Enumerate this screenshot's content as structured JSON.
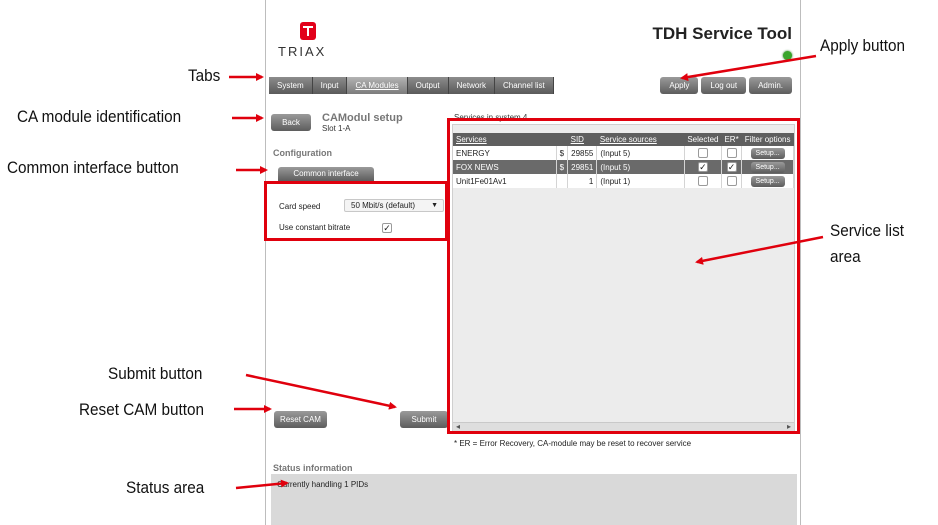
{
  "app": {
    "logo_text": "TRIAX",
    "title": "TDH Service Tool"
  },
  "tabs": [
    {
      "label": "System",
      "active": false
    },
    {
      "label": "Input",
      "active": false
    },
    {
      "label": "CA Modules",
      "active": true
    },
    {
      "label": "Output",
      "active": false
    },
    {
      "label": "Network",
      "active": false
    },
    {
      "label": "Channel list",
      "active": false
    }
  ],
  "top_buttons": {
    "apply": "Apply",
    "logout": "Log out",
    "admin": "Admin."
  },
  "module": {
    "back": "Back",
    "name": "CAModul setup",
    "slot": "Slot 1-A"
  },
  "configuration": {
    "title": "Configuration",
    "ci_button": "Common interface",
    "card_speed_label": "Card speed",
    "card_speed_value": "50 Mbit/s (default)",
    "constant_bitrate_label": "Use constant bitrate",
    "constant_bitrate_checked": "✓"
  },
  "actions": {
    "reset": "Reset CAM",
    "submit": "Submit"
  },
  "services": {
    "caption": "Services in system 4",
    "headers": {
      "service": "Services",
      "sid": "SID",
      "sources": "Service sources",
      "selected": "Selected",
      "er": "ER*",
      "filter": "Filter options"
    },
    "rows": [
      {
        "name": "ENERGY",
        "currency": "$",
        "sid": "29855",
        "source": "(Input 5)",
        "selected": "",
        "er": "",
        "setup": "Setup..."
      },
      {
        "name": "FOX NEWS",
        "currency": "$",
        "sid": "29851",
        "source": "(Input 5)",
        "selected": "✓",
        "er": "✓",
        "setup": "Setup..."
      },
      {
        "name": "Unit1Fe01Av1",
        "currency": "",
        "sid": "1",
        "source": "(Input 1)",
        "selected": "",
        "er": "",
        "setup": "Setup..."
      }
    ],
    "footnote": "* ER = Error Recovery, CA-module may be reset to recover service"
  },
  "status": {
    "title": "Status information",
    "text": "Currently handling   1 PIDs"
  },
  "annotations": {
    "tabs": "Tabs",
    "ca_module": "CA module identification",
    "common_interface": "Common interface button",
    "submit": "Submit button",
    "reset_cam": "Reset CAM button",
    "status_area": "Status area",
    "apply": "Apply button",
    "service_list_1": "Service list",
    "service_list_2": "area",
    "color": "#e0000d"
  }
}
